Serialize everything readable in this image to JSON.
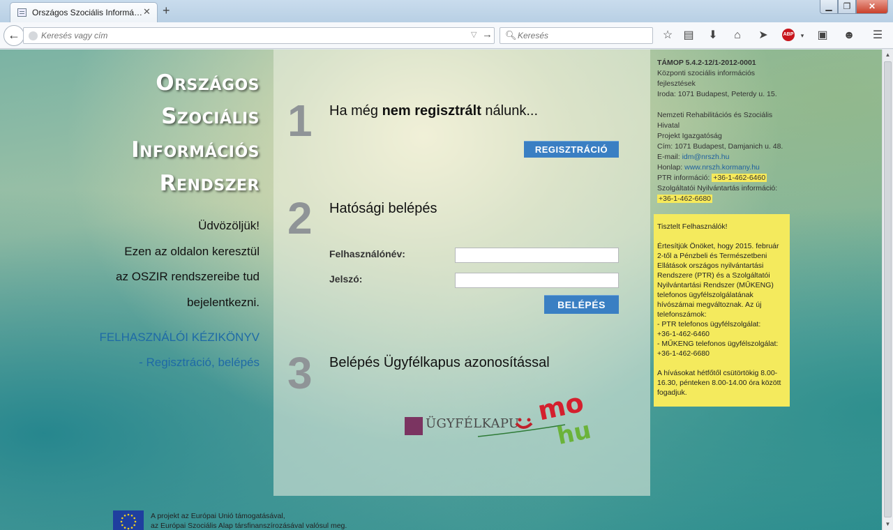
{
  "browser": {
    "tab_title": "Országos Szociális Informá…",
    "tab_close": "✕",
    "new_tab": "+",
    "url_placeholder": "Keresés vagy cím",
    "search_placeholder": "Keresés",
    "abp_label": "ABP",
    "icons": [
      "back-arrow-icon",
      "globe-icon",
      "dropdown-icon",
      "go-arrow-icon",
      "search-icon",
      "star-icon",
      "reading-list-icon",
      "download-icon",
      "home-icon",
      "send-icon",
      "adblock-icon",
      "screenshot-icon",
      "chat-icon",
      "menu-icon"
    ]
  },
  "site": {
    "title_lines": [
      "Országos",
      "Szociális",
      "Információs",
      "Rendszer"
    ],
    "welcome_lines": [
      "Üdvözöljük!",
      "Ezen az oldalon keresztül",
      "az OSZIR rendszereibe tud",
      "bejelentkezni."
    ],
    "manual_link": "FELHASZNÁLÓI KÉZIKÖNYV",
    "reg_link": "- Regisztráció, belépés"
  },
  "steps": {
    "s1": {
      "num": "1",
      "title_pre": "Ha még ",
      "title_bold": "nem regisztrált",
      "title_post": " nálunk...",
      "button": "REGISZTRÁCIÓ"
    },
    "s2": {
      "num": "2",
      "title": "Hatósági belépés",
      "username_label": "Felhasználónév:",
      "password_label": "Jelszó:",
      "username_value": "",
      "password_value": "",
      "button": "BELÉPÉS"
    },
    "s3": {
      "num": "3",
      "title": "Belépés Ügyfélkapus azonosítással",
      "logo_text": "ÜGYFÉLKAPU",
      "mo_text": "mo",
      "hu_text": "hu"
    }
  },
  "sidebar": {
    "project_code": "TÁMOP 5.4.2-12/1-2012-0001",
    "project_desc": "Központi szociális információs fejlesztések",
    "office": "Iroda: 1071 Budapest, Peterdy u. 15.",
    "org": "Nemzeti Rehabilitációs és Szociális Hivatal",
    "dept": "Projekt Igazgatóság",
    "address": "Cím: 1071 Budapest, Damjanich u. 48.",
    "email_label": "E-mail: ",
    "email": "idm@nrszh.hu",
    "web_label": "Honlap: ",
    "web": "www.nrszh.kormany.hu",
    "ptr_label": "PTR információ: ",
    "ptr_phone": "+36-1-462-6460",
    "szny_label": "Szolgáltatói Nyilvántartás információ:",
    "szny_phone": "+36-1-462-6680"
  },
  "notice": {
    "greeting": "Tisztelt Felhasználók!",
    "body": "Értesítjük Önöket, hogy 2015. február 2-től a Pénzbeli és Természetbeni Ellátások országos nyilvántartási Rendszere (PTR) és a Szolgáltatói Nyilvántartási Rendszer (MŰKENG) telefonos ügyfélszolgálatának hívószámai megváltoznak. Az új telefonszámok:",
    "ptr_line": "- PTR telefonos ügyfélszolgálat:",
    "ptr_phone": "+36-1-462-6460",
    "mukeng_line": "- MŰKENG telefonos ügyfélszolgálat:",
    "mukeng_phone": "+36-1-462-6680",
    "hours": "A hívásokat hétfőtől csütörtökig 8.00-16.30, pénteken 8.00-14.00 óra között fogadjuk."
  },
  "footer": {
    "line1": "A projekt az Európai Unió támogatásával,",
    "line2": "az Európai Szociális Alap társfinanszírozásával valósul meg."
  },
  "colors": {
    "accent_button": "#3a7fc3",
    "notice_bg": "#f4ea5d",
    "link": "#1e6aa6",
    "title_text": "#ffffff"
  }
}
